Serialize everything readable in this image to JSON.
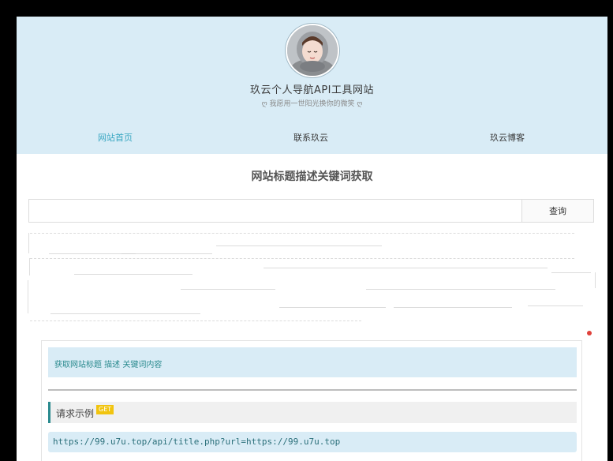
{
  "header": {
    "site_title": "玖云个人导航API工具网站",
    "site_subtitle": "ღ 我愿用一世阳光换你的微笑 ღ",
    "avatar_icon": "user-avatar-photo"
  },
  "nav": {
    "items": [
      {
        "label": "网站首页",
        "active": true
      },
      {
        "label": "联系玖云",
        "active": false
      },
      {
        "label": "玖云博客",
        "active": false
      }
    ]
  },
  "tool": {
    "title": "网站标题描述关键词获取",
    "search_value": "",
    "search_placeholder": "",
    "search_button": "查询"
  },
  "doc": {
    "description": "获取网站标题 描述 关键词内容",
    "section_label": "请求示例",
    "method_badge": "GET",
    "example_url": "https://99.u7u.top/api/title.php?url=https://99.u7u.top"
  },
  "colors": {
    "header_bg": "#d9ecf6",
    "accent": "#3aa7c2",
    "doc_accent": "#2a8a8e",
    "badge": "#f1c40f",
    "notify_dot": "#e0413b"
  }
}
